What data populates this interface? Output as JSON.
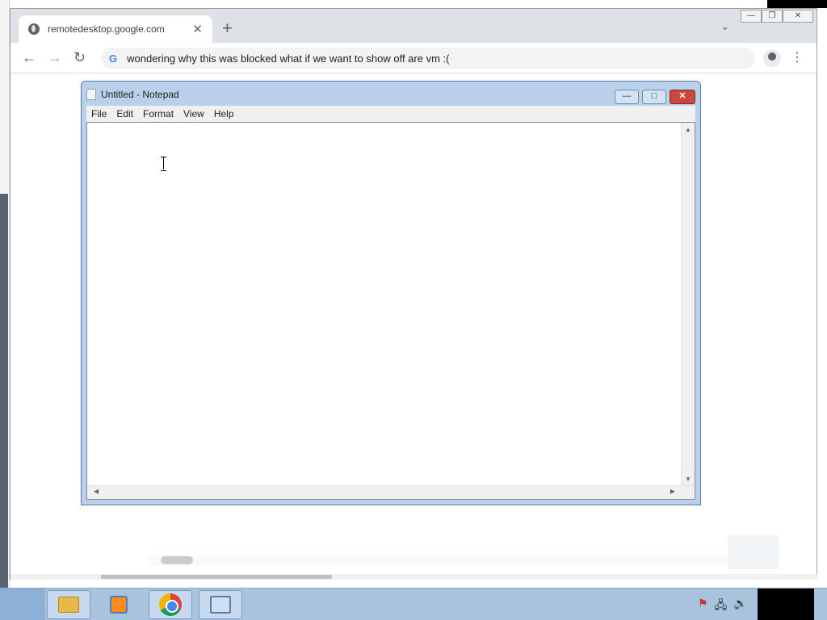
{
  "browser": {
    "tab": {
      "title": "remotedesktop.google.com",
      "close": "✕"
    },
    "new_tab": "+",
    "tab_search": "⌄",
    "controls": {
      "minimize": "—",
      "restore": "❐",
      "close": "✕"
    },
    "toolbar": {
      "back": "←",
      "forward": "→",
      "reload": "↻",
      "omnibox_icon": "G",
      "omnibox_text": "wondering why this was blocked what if we want to show off are vm :(",
      "menu": "⋮"
    }
  },
  "notepad": {
    "title": "Untitled - Notepad",
    "menu": [
      "File",
      "Edit",
      "Format",
      "View",
      "Help"
    ],
    "controls": {
      "minimize": "—",
      "maximize": "□",
      "close": "✕"
    },
    "content": ""
  },
  "taskbar": {
    "apps": [
      "folder-icon",
      "media-player-icon",
      "chrome-icon",
      "remote-desktop-icon"
    ],
    "tray": [
      "flag-icon",
      "network-icon",
      "volume-icon"
    ],
    "tray_glyphs": {
      "flag": "⚑",
      "network": "🖧",
      "volume": "🔊"
    }
  }
}
